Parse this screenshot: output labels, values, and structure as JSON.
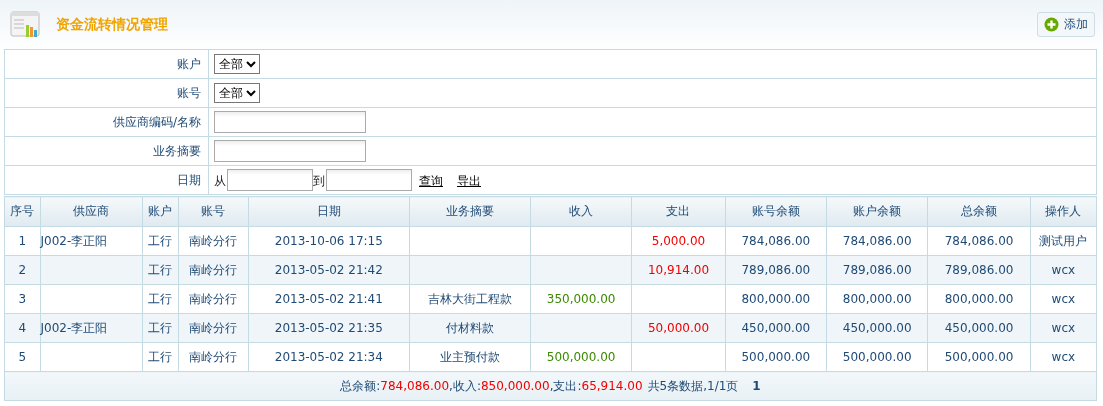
{
  "header": {
    "title": "资金流转情况管理",
    "add_button": "添加"
  },
  "filters": [
    {
      "label": "账户",
      "kind": "select",
      "value": "全部"
    },
    {
      "label": "账号",
      "kind": "select",
      "value": "全部"
    },
    {
      "label": "供应商编码/名称",
      "kind": "input"
    },
    {
      "label": "业务摘要",
      "kind": "input"
    },
    {
      "label": "日期",
      "kind": "daterange",
      "from": "从",
      "to": "到",
      "links": [
        "查询",
        "导出"
      ]
    }
  ],
  "table": {
    "columns": [
      "序号",
      "供应商",
      "账户",
      "账号",
      "日期",
      "业务摘要",
      "收入",
      "支出",
      "账号余额",
      "账户余额",
      "总余额",
      "操作人"
    ],
    "rows": [
      [
        "1",
        "J002-李正阳",
        "工行",
        "南岭分行",
        "2013-10-06 17:15",
        "",
        "",
        "5,000.00",
        "784,086.00",
        "784,086.00",
        "784,086.00",
        "测试用户"
      ],
      [
        "2",
        "",
        "工行",
        "南岭分行",
        "2013-05-02 21:42",
        "",
        "",
        "10,914.00",
        "789,086.00",
        "789,086.00",
        "789,086.00",
        "wcx"
      ],
      [
        "3",
        "",
        "工行",
        "南岭分行",
        "2013-05-02 21:41",
        "吉林大街工程款",
        "350,000.00",
        "",
        "800,000.00",
        "800,000.00",
        "800,000.00",
        "wcx"
      ],
      [
        "4",
        "J002-李正阳",
        "工行",
        "南岭分行",
        "2013-05-02 21:35",
        "付材料款",
        "",
        "50,000.00",
        "450,000.00",
        "450,000.00",
        "450,000.00",
        "wcx"
      ],
      [
        "5",
        "",
        "工行",
        "南岭分行",
        "2013-05-02 21:34",
        "业主预付款",
        "500,000.00",
        "",
        "500,000.00",
        "500,000.00",
        "500,000.00",
        "wcx"
      ]
    ]
  },
  "footer": {
    "totals": [
      {
        "label": "总余额:",
        "value": "784,086.00"
      },
      {
        "label": ",收入:",
        "value": "850,000.00"
      },
      {
        "label": ",支出:",
        "value": "65,914.00"
      }
    ],
    "summary": "共5条数据,1/1页",
    "page": "1"
  }
}
